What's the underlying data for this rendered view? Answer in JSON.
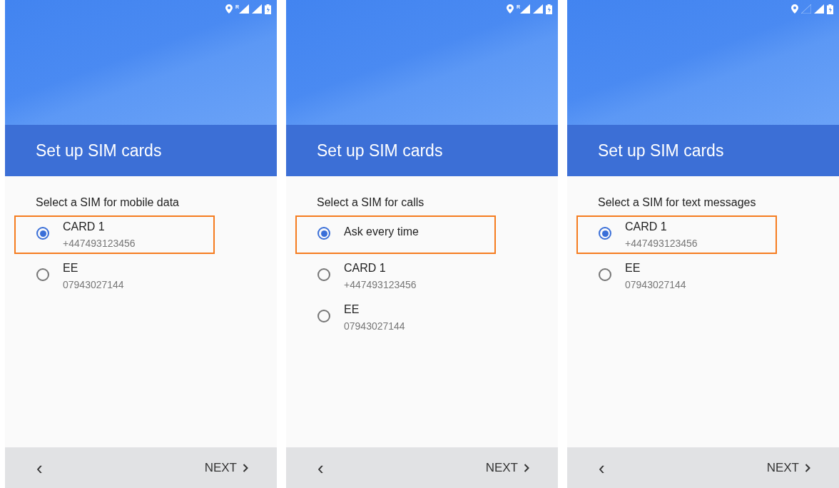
{
  "screens": [
    {
      "status": {
        "roaming": "R"
      },
      "title": "Set up SIM cards",
      "prompt": "Select a SIM for mobile data",
      "options": [
        {
          "name": "CARD 1",
          "number": "+447493123456",
          "selected": true,
          "highlighted": true
        },
        {
          "name": "EE",
          "number": "07943027144",
          "selected": false,
          "highlighted": false
        }
      ],
      "back": "‹",
      "next": "NEXT"
    },
    {
      "status": {
        "roaming": "R"
      },
      "title": "Set up SIM cards",
      "prompt": "Select a SIM for calls",
      "options": [
        {
          "name": "Ask every time",
          "selected": true,
          "highlighted": true
        },
        {
          "name": "CARD 1",
          "number": "+447493123456",
          "selected": false,
          "highlighted": false
        },
        {
          "name": "EE",
          "number": "07943027144",
          "selected": false,
          "highlighted": false
        }
      ],
      "back": "‹",
      "next": "NEXT"
    },
    {
      "title": "Set up SIM cards",
      "prompt": "Select a SIM for text messages",
      "options": [
        {
          "name": "CARD 1",
          "number": "+447493123456",
          "selected": true,
          "highlighted": true
        },
        {
          "name": "EE",
          "number": "07943027144",
          "selected": false,
          "highlighted": false
        }
      ],
      "back": "‹",
      "next": "NEXT"
    }
  ]
}
